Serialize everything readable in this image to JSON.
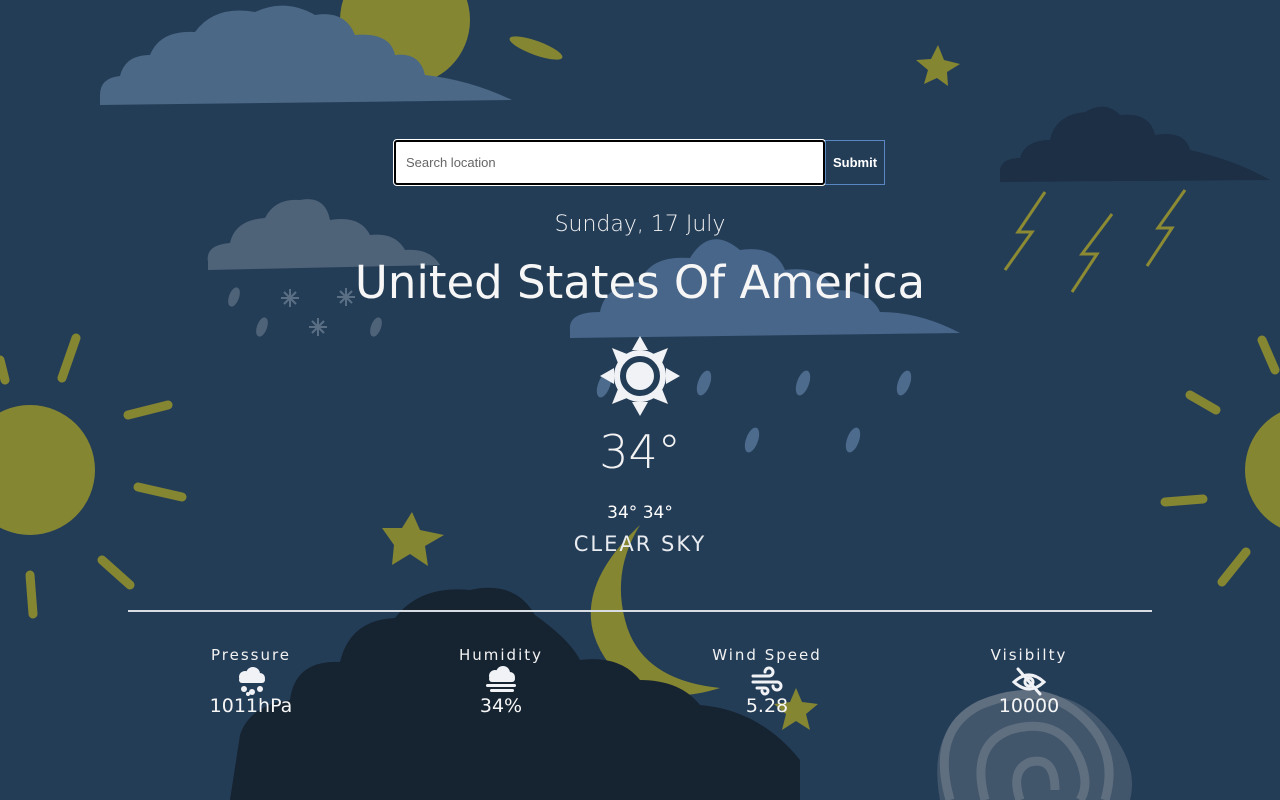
{
  "search": {
    "placeholder": "Search location",
    "submit_label": "Submit"
  },
  "current": {
    "date": "Sunday, 17 July",
    "location": "United States Of America",
    "temperature": "34°",
    "min_max": "34° 34°",
    "description": "CLEAR SKY",
    "icon": "sun-icon"
  },
  "stats": [
    {
      "label": "Pressure",
      "value": "1011hPa",
      "icon": "cloud-hail-icon"
    },
    {
      "label": "Humidity",
      "value": "34%",
      "icon": "cloud-fog-icon"
    },
    {
      "label": "Wind Speed",
      "value": "5.28",
      "icon": "wind-icon"
    },
    {
      "label": "Visibilty",
      "value": "10000",
      "icon": "eye-slash-icon"
    }
  ],
  "colors": {
    "background": "#243d57",
    "accent_yellow": "#8c8a33",
    "text": "#f0f2f5"
  }
}
